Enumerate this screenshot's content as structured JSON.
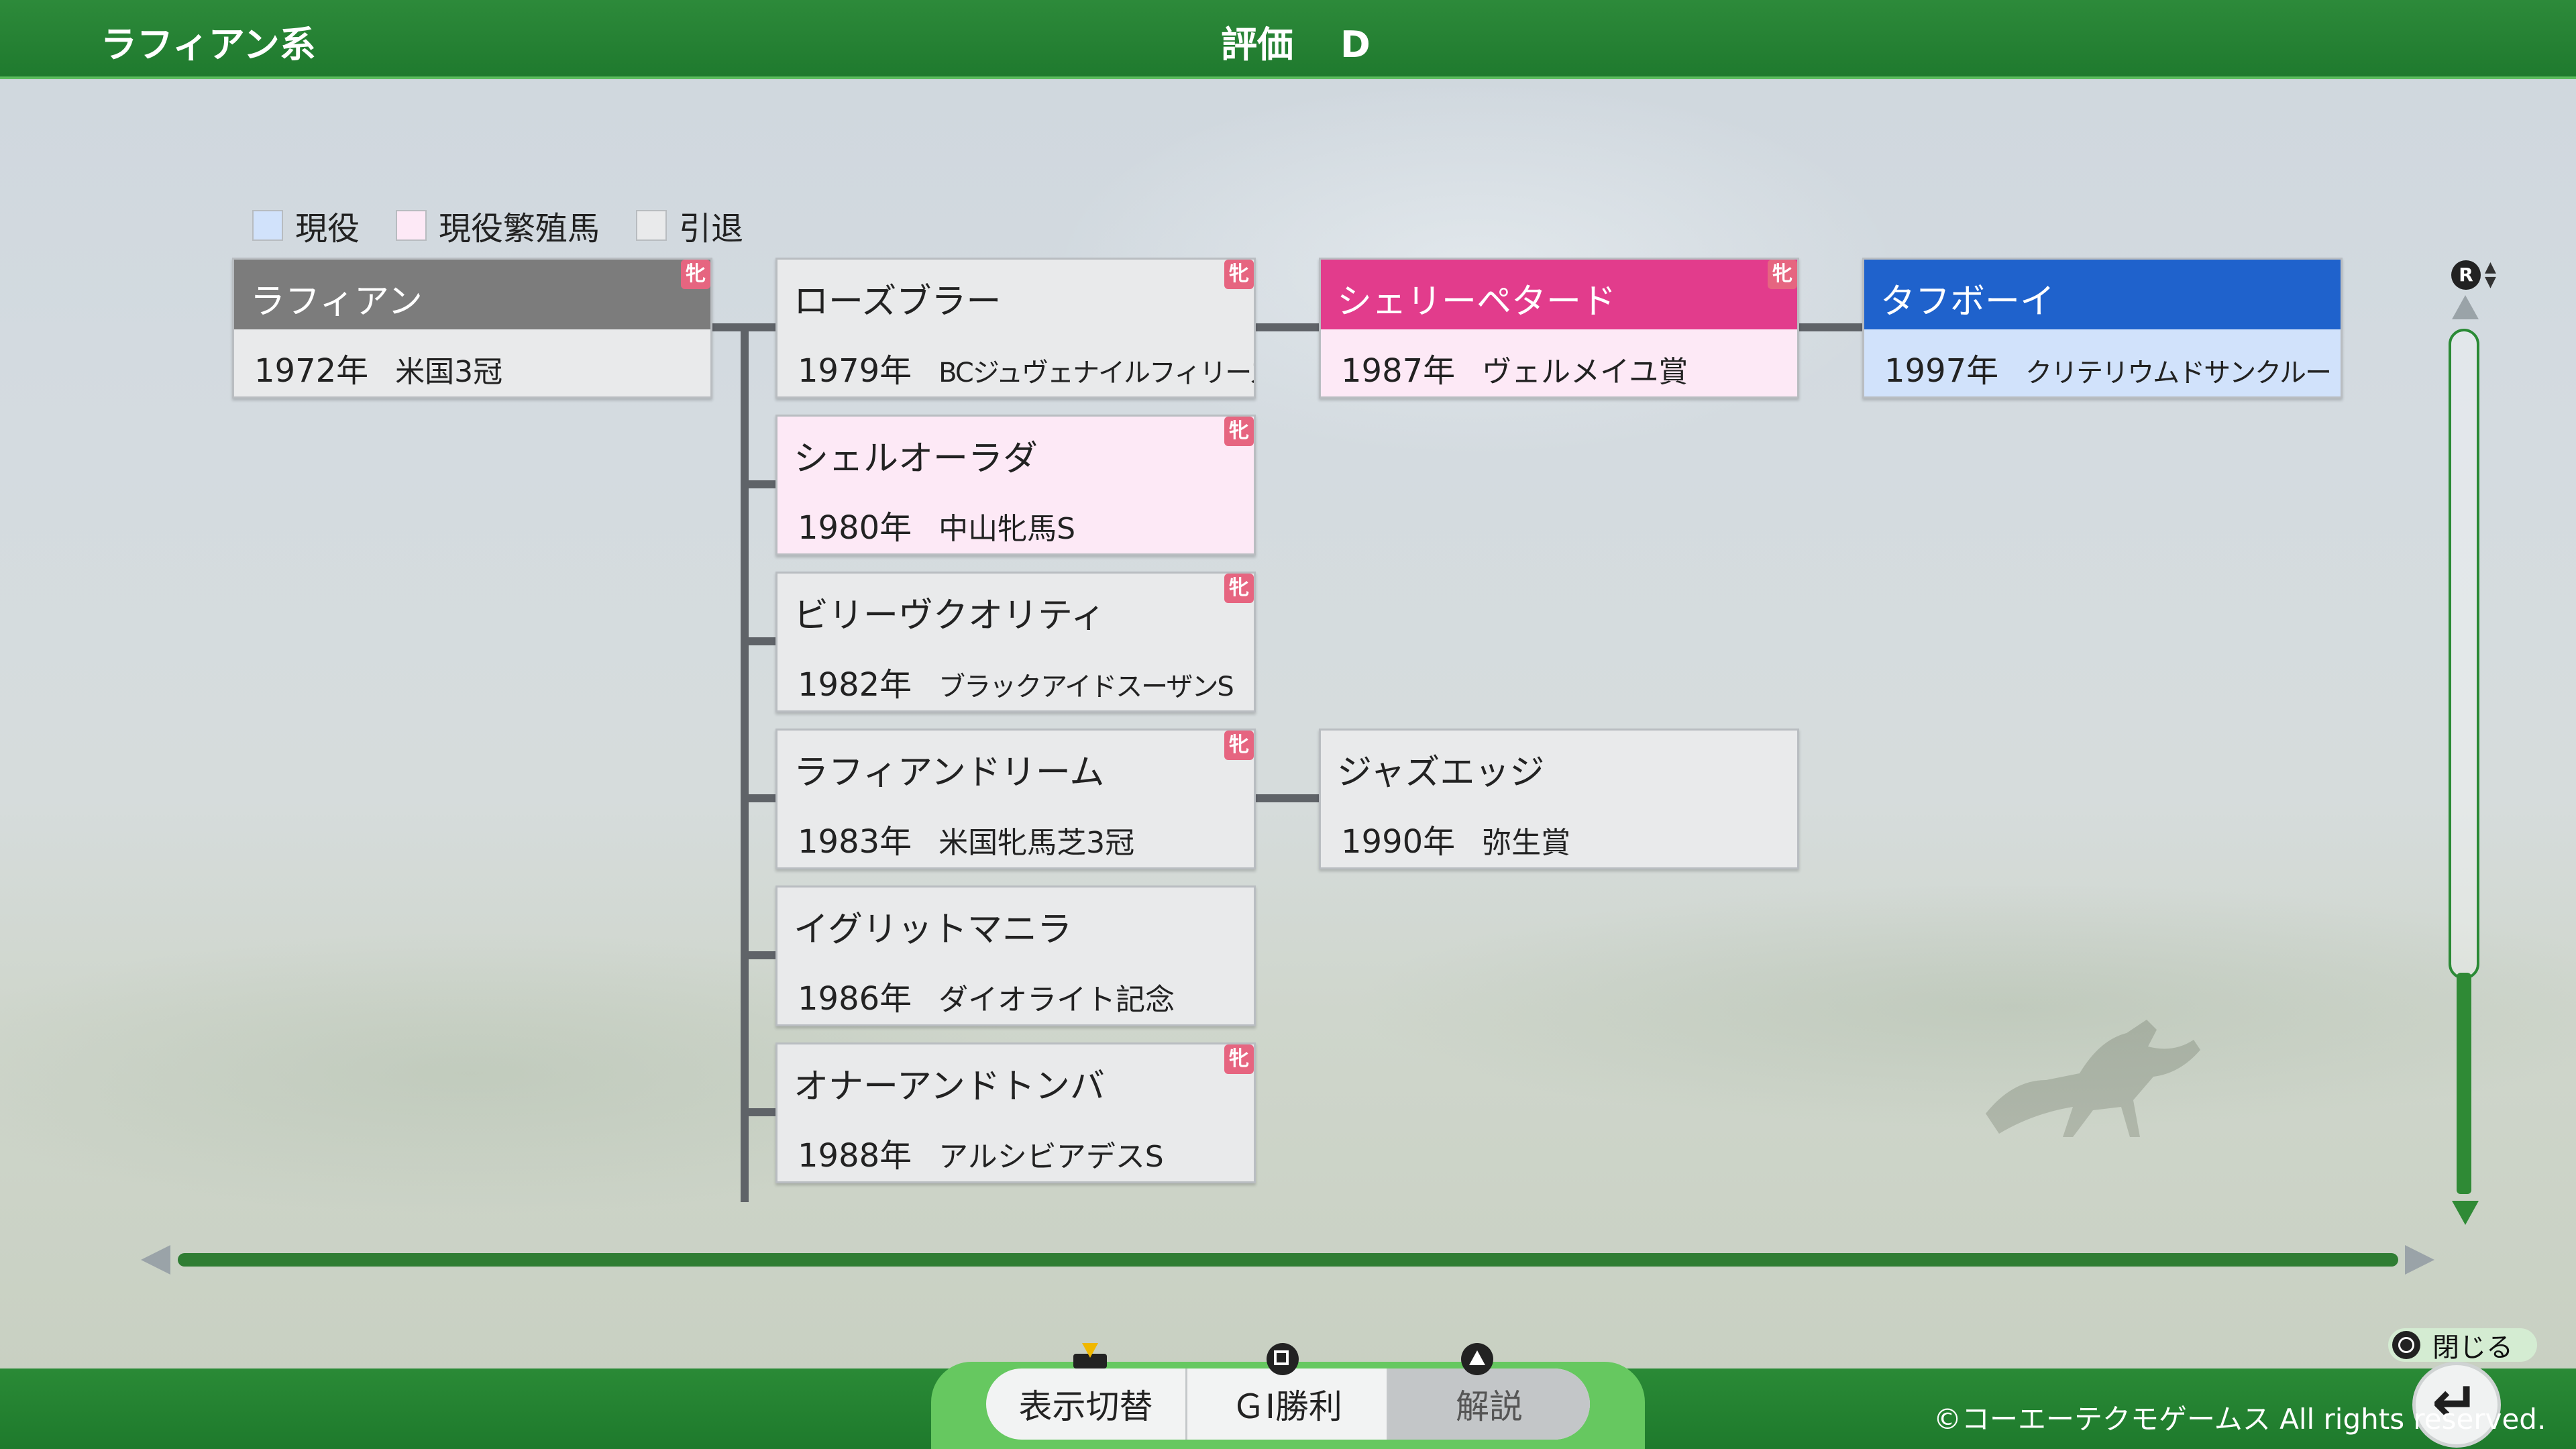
{
  "header": {
    "lineage_title": "ラフィアン系",
    "eval_label": "評価",
    "eval_grade": "D"
  },
  "legend": [
    {
      "label": "現役",
      "color": "#d1e2fb"
    },
    {
      "label": "現役繁殖馬",
      "color": "#fde9f6"
    },
    {
      "label": "引退",
      "color": "#e9eaeb"
    }
  ],
  "mare_badge": "牝",
  "horses": {
    "root": {
      "name": "ラフィアン",
      "year": "1972年",
      "race": "米国3冠",
      "mare": true
    },
    "c1": {
      "name": "ローズブラー",
      "year": "1979年",
      "race": "BCジュヴェナイルフィリーズ",
      "mare": true
    },
    "c2": {
      "name": "シェルオーラダ",
      "year": "1980年",
      "race": "中山牝馬S",
      "mare": true
    },
    "c3": {
      "name": "ビリーヴクオリティ",
      "year": "1982年",
      "race": "ブラックアイドスーザンS",
      "mare": true
    },
    "c4": {
      "name": "ラフィアンドリーム",
      "year": "1983年",
      "race": "米国牝馬芝3冠",
      "mare": true
    },
    "c5": {
      "name": "イグリットマニラ",
      "year": "1986年",
      "race": "ダイオライト記念",
      "mare": false
    },
    "c6": {
      "name": "オナーアンドトンバ",
      "year": "1988年",
      "race": "アルシビアデスS",
      "mare": true
    },
    "g1": {
      "name": "シェリーペタード",
      "year": "1987年",
      "race": "ヴェルメイユ賞",
      "mare": true
    },
    "g2": {
      "name": "ジャズエッジ",
      "year": "1990年",
      "race": "弥生賞",
      "mare": false
    },
    "gg1": {
      "name": "タフボーイ",
      "year": "1997年",
      "race": "クリテリウムドサンクルー",
      "mare": false
    }
  },
  "controls": {
    "toggle_display": "表示切替",
    "g1_wins": "ＧⅠ勝利",
    "explanation": "解説",
    "close": "閉じる",
    "r_button": "R"
  },
  "footer": {
    "copyright": "©コーエーテクモゲームス All rights reserved."
  }
}
